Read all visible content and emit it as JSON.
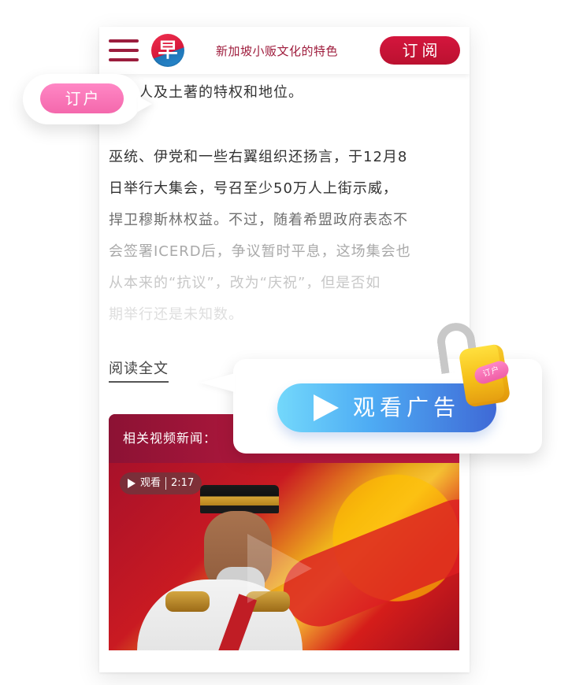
{
  "header": {
    "logo_char": "早",
    "title": "新加坡小贩文化的特色",
    "subscribe_label": "订阅"
  },
  "overlay": {
    "user_label": "订户",
    "ad_label": "观看广告",
    "lock_tag": "订户"
  },
  "article": {
    "paragraph1": [
      "马来人及土著的特权和地位。"
    ],
    "paragraph2": [
      "巫统、伊党和一些右翼组织还扬言，于12月8",
      "日举行大集会，号召至少50万人上街示威，",
      "捍卫穆斯林权益。不过，随着希盟政府表态不",
      "会签署ICERD后，争议暂时平息，这场集会也",
      "从本来的“抗议”，改为“庆祝”，但是否如",
      "期举行还是未知数。"
    ],
    "read_full": "阅读全文"
  },
  "video": {
    "section_title": "相关视频新闻：",
    "watch_label": "观看",
    "duration": "2:17"
  },
  "colors": {
    "brand_red": "#C8163A",
    "brand_purple": "#9B1D3D",
    "user_pink": "#F468AC",
    "ad_blue": "#4EACF4"
  },
  "icons": {
    "menu": "menu-icon",
    "logo": "logo-icon",
    "play": "play-icon",
    "lock": "lock-icon"
  }
}
